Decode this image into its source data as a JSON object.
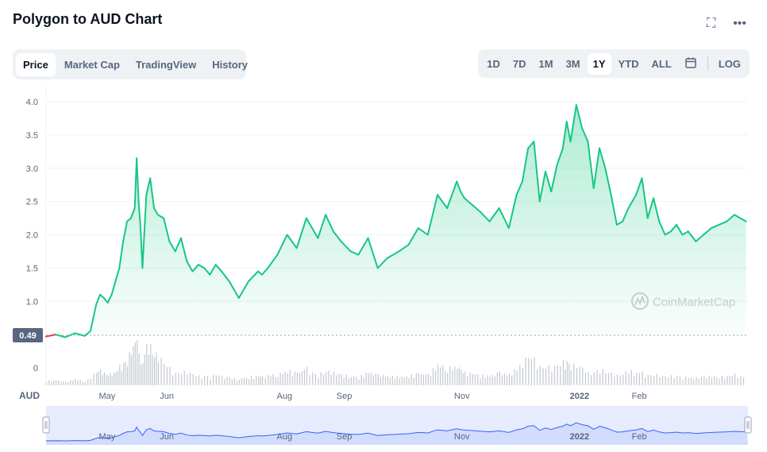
{
  "header": {
    "title": "Polygon to AUD Chart",
    "expand_icon": "expand-icon",
    "more_icon": "more-icon"
  },
  "view_tabs": [
    {
      "label": "Price",
      "active": true
    },
    {
      "label": "Market Cap",
      "active": false
    },
    {
      "label": "TradingView",
      "active": false
    },
    {
      "label": "History",
      "active": false
    }
  ],
  "range_buttons": [
    {
      "label": "1D",
      "active": false
    },
    {
      "label": "7D",
      "active": false
    },
    {
      "label": "1M",
      "active": false
    },
    {
      "label": "3M",
      "active": false
    },
    {
      "label": "1Y",
      "active": true
    },
    {
      "label": "YTD",
      "active": false
    },
    {
      "label": "ALL",
      "active": false
    }
  ],
  "calendar_icon": "calendar-icon",
  "log_label": "LOG",
  "watermark": "CoinMarketCap",
  "colors": {
    "up": "#16c784",
    "down": "#ea3943",
    "navigator_line": "#3861fb",
    "volume": "#c3c8d0"
  },
  "chart_data": {
    "type": "line",
    "xlabel": "",
    "ylabel": "",
    "currency_label": "AUD",
    "ylim": [
      0,
      4.0
    ],
    "y_ticks": [
      1.0,
      1.5,
      2.0,
      2.5,
      3.0,
      3.5,
      4.0
    ],
    "baseline_value": 0.49,
    "baseline_label": "0.49",
    "volume_axis_tick": "0",
    "x_ticks": [
      {
        "label": "May",
        "date": "2021-05-01"
      },
      {
        "label": "Jun",
        "date": "2021-06-01"
      },
      {
        "label": "Aug",
        "date": "2021-08-01"
      },
      {
        "label": "Sep",
        "date": "2021-09-01"
      },
      {
        "label": "Nov",
        "date": "2021-11-01"
      },
      {
        "label": "2022",
        "date": "2022-01-01",
        "bold": true
      },
      {
        "label": "Feb",
        "date": "2022-02-01"
      }
    ],
    "x_range": [
      "2021-04-01",
      "2022-03-31"
    ],
    "grid": true,
    "series": [
      {
        "dates": [
          "2021-04-01",
          "2021-04-06",
          "2021-04-11",
          "2021-04-16",
          "2021-04-21",
          "2021-04-24",
          "2021-04-27",
          "2021-04-29",
          "2021-05-01",
          "2021-05-03",
          "2021-05-05",
          "2021-05-07",
          "2021-05-09",
          "2021-05-11",
          "2021-05-13",
          "2021-05-15",
          "2021-05-17",
          "2021-05-18",
          "2021-05-19",
          "2021-05-20",
          "2021-05-21",
          "2021-05-23",
          "2021-05-25",
          "2021-05-27",
          "2021-05-29",
          "2021-06-01",
          "2021-06-04",
          "2021-06-07",
          "2021-06-10",
          "2021-06-13",
          "2021-06-16",
          "2021-06-19",
          "2021-06-22",
          "2021-06-25",
          "2021-06-28",
          "2021-07-01",
          "2021-07-05",
          "2021-07-10",
          "2021-07-15",
          "2021-07-20",
          "2021-07-22",
          "2021-07-25",
          "2021-07-30",
          "2021-08-04",
          "2021-08-09",
          "2021-08-14",
          "2021-08-17",
          "2021-08-20",
          "2021-08-24",
          "2021-08-28",
          "2021-09-01",
          "2021-09-06",
          "2021-09-10",
          "2021-09-15",
          "2021-09-20",
          "2021-09-25",
          "2021-10-01",
          "2021-10-06",
          "2021-10-11",
          "2021-10-16",
          "2021-10-21",
          "2021-10-26",
          "2021-10-31",
          "2021-11-02",
          "2021-11-04",
          "2021-11-08",
          "2021-11-12",
          "2021-11-17",
          "2021-11-22",
          "2021-11-27",
          "2021-12-01",
          "2021-12-04",
          "2021-12-07",
          "2021-12-10",
          "2021-12-13",
          "2021-12-16",
          "2021-12-19",
          "2021-12-22",
          "2021-12-25",
          "2021-12-27",
          "2021-12-29",
          "2022-01-01",
          "2022-01-04",
          "2022-01-07",
          "2022-01-10",
          "2022-01-13",
          "2022-01-16",
          "2022-01-19",
          "2022-01-22",
          "2022-01-25",
          "2022-01-28",
          "2022-02-01",
          "2022-02-04",
          "2022-02-07",
          "2022-02-10",
          "2022-02-13",
          "2022-02-16",
          "2022-02-19",
          "2022-02-22",
          "2022-02-25",
          "2022-02-28",
          "2022-03-04",
          "2022-03-08",
          "2022-03-12",
          "2022-03-16",
          "2022-03-20",
          "2022-03-24",
          "2022-03-27",
          "2022-03-30"
        ],
        "values": [
          0.47,
          0.5,
          0.46,
          0.52,
          0.48,
          0.55,
          0.95,
          1.1,
          1.05,
          0.98,
          1.1,
          1.3,
          1.5,
          1.9,
          2.2,
          2.25,
          2.4,
          3.15,
          2.5,
          2.1,
          1.5,
          2.6,
          2.85,
          2.4,
          2.3,
          2.25,
          1.9,
          1.75,
          1.95,
          1.6,
          1.45,
          1.55,
          1.5,
          1.4,
          1.55,
          1.45,
          1.3,
          1.05,
          1.3,
          1.45,
          1.4,
          1.5,
          1.7,
          2.0,
          1.8,
          2.25,
          2.1,
          1.95,
          2.3,
          2.05,
          1.9,
          1.75,
          1.7,
          1.95,
          1.5,
          1.65,
          1.75,
          1.85,
          2.1,
          2.0,
          2.6,
          2.4,
          2.8,
          2.65,
          2.55,
          2.45,
          2.35,
          2.2,
          2.4,
          2.1,
          2.6,
          2.8,
          3.3,
          3.4,
          2.5,
          2.95,
          2.65,
          3.05,
          3.3,
          3.7,
          3.4,
          3.95,
          3.6,
          3.4,
          2.7,
          3.3,
          3.0,
          2.6,
          2.15,
          2.2,
          2.4,
          2.6,
          2.85,
          2.25,
          2.55,
          2.2,
          2.0,
          2.05,
          2.15,
          2.0,
          2.05,
          1.9,
          2.0,
          2.1,
          2.15,
          2.2,
          2.3,
          2.25,
          2.2
        ]
      }
    ],
    "volume_relative": [
      0.1,
      0.12,
      0.08,
      0.15,
      0.1,
      0.2,
      0.3,
      0.35,
      0.3,
      0.28,
      0.25,
      0.3,
      0.45,
      0.55,
      0.65,
      0.8,
      0.95,
      1.0,
      0.85,
      0.7,
      0.55,
      0.9,
      0.95,
      0.8,
      0.7,
      0.5,
      0.4,
      0.3,
      0.35,
      0.3,
      0.25,
      0.22,
      0.25,
      0.2,
      0.25,
      0.2,
      0.18,
      0.15,
      0.2,
      0.22,
      0.2,
      0.25,
      0.25,
      0.35,
      0.28,
      0.4,
      0.32,
      0.25,
      0.35,
      0.3,
      0.25,
      0.22,
      0.2,
      0.3,
      0.25,
      0.22,
      0.2,
      0.22,
      0.28,
      0.25,
      0.5,
      0.4,
      0.45,
      0.35,
      0.3,
      0.28,
      0.25,
      0.22,
      0.3,
      0.25,
      0.4,
      0.55,
      0.65,
      0.6,
      0.45,
      0.5,
      0.4,
      0.45,
      0.55,
      0.6,
      0.5,
      0.45,
      0.4,
      0.3,
      0.35,
      0.4,
      0.3,
      0.28,
      0.25,
      0.3,
      0.35,
      0.3,
      0.3,
      0.25,
      0.28,
      0.22,
      0.2,
      0.22,
      0.25,
      0.2,
      0.18,
      0.18,
      0.2,
      0.22,
      0.2,
      0.22,
      0.25,
      0.22,
      0.2
    ]
  }
}
